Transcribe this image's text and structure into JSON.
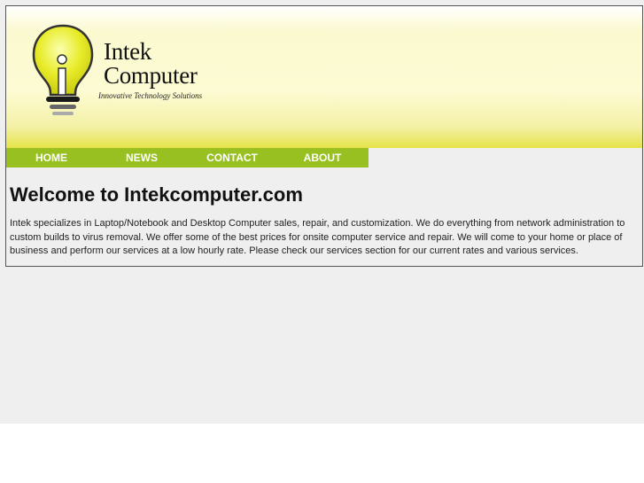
{
  "header": {
    "logo_line1": "Intek",
    "logo_line2": "Computer",
    "tagline": "Innovative Technology Solutions"
  },
  "nav": {
    "items": [
      {
        "label": "HOME"
      },
      {
        "label": "NEWS"
      },
      {
        "label": "CONTACT"
      },
      {
        "label": "ABOUT"
      }
    ]
  },
  "main": {
    "title": "Welcome to Intekcomputer.com",
    "body": "Intek specializes in Laptop/Notebook and Desktop Computer sales, repair, and customization. We do everything from network administration to custom builds to virus removal. We offer some of the best prices for onsite computer service and repair. We will come to your home or place of business and perform our services at a low hourly rate. Please check our services section for our current rates and various services."
  },
  "colors": {
    "nav_background": "#98c021",
    "bulb_yellow": "#e8ec2a",
    "page_background": "#efefef"
  },
  "icons": {
    "logo": "lightbulb-icon"
  }
}
